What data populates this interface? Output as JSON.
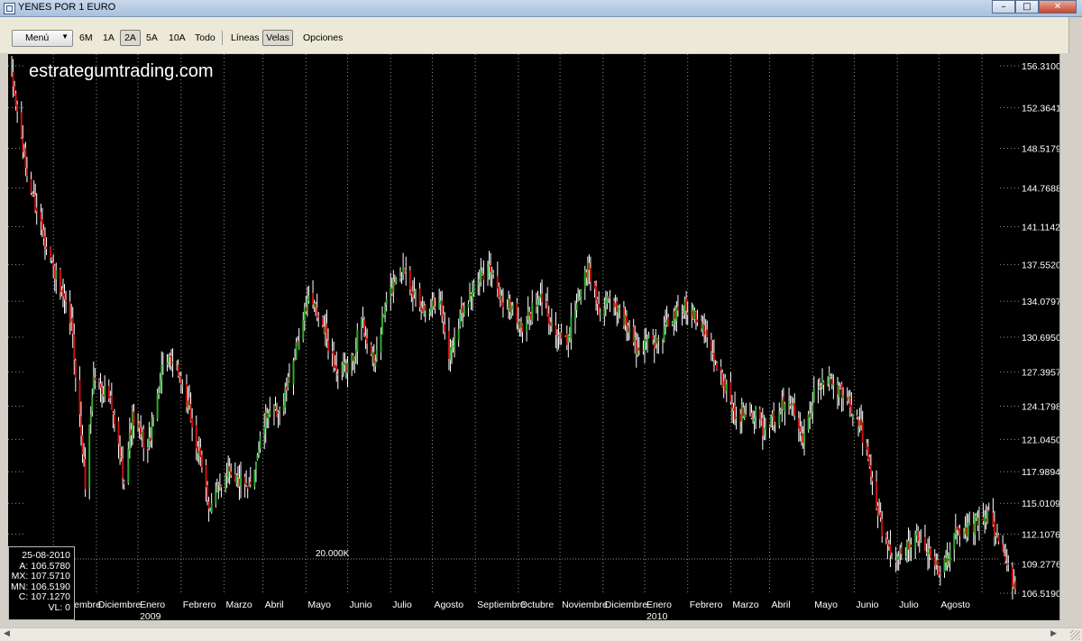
{
  "window": {
    "title": "YENES POR 1 EURO",
    "buttons": [
      "minimize",
      "maximize",
      "close"
    ]
  },
  "toolbar": {
    "menu_label": "Menú",
    "periods": [
      "6M",
      "1A",
      "2A",
      "5A",
      "10A",
      "Todo"
    ],
    "selected_period": "2A",
    "lines_label": "Líneas",
    "candles_label": "Velas",
    "options_label": "Opciones",
    "selected_style": "Velas"
  },
  "watermark": "estrategumtrading.com",
  "infobox": {
    "date": "25-08-2010",
    "open": "A: 106.5780",
    "high": "MX: 107.5710",
    "low": "MN: 106.5190",
    "close": "C: 107.1270",
    "volume": "VL: 0"
  },
  "colors": {
    "background": "#000000",
    "up": "#2ea82e",
    "down": "#c81010",
    "wick": "#ffffff",
    "grid": "#909090",
    "text": "#ffffff"
  },
  "chart_data": {
    "type": "candlestick",
    "series": [
      {
        "name": "YENES POR 1 EURO",
        "ohlc": []
      }
    ],
    "y_ticks": [
      "156.3100",
      "152.3641",
      "148.5179",
      "144.7688",
      "141.1142",
      "137.5520",
      "134.0797",
      "130.6950",
      "127.3957",
      "124.1798",
      "121.0450",
      "117.9894",
      "115.0109",
      "112.1076",
      "109.2776",
      "106.5190"
    ],
    "x_ticks": [
      {
        "label": "Noviembre"
      },
      {
        "label": "Diciembre"
      },
      {
        "label": "Enero",
        "year": "2009"
      },
      {
        "label": "Febrero"
      },
      {
        "label": "Marzo"
      },
      {
        "label": "Abril"
      },
      {
        "label": "Mayo"
      },
      {
        "label": "Junio"
      },
      {
        "label": "Julio"
      },
      {
        "label": "Agosto"
      },
      {
        "label": "Septiembre"
      },
      {
        "label": "Octubre"
      },
      {
        "label": "Noviembre"
      },
      {
        "label": "Diciembre"
      },
      {
        "label": "Enero",
        "year": "2010"
      },
      {
        "label": "Febrero"
      },
      {
        "label": "Marzo"
      },
      {
        "label": "Abril"
      },
      {
        "label": "Mayo"
      },
      {
        "label": "Junio"
      },
      {
        "label": "Julio"
      },
      {
        "label": "Agosto"
      }
    ],
    "volume_label": "20.000K",
    "anchors": [
      {
        "d": "2008-09-01",
        "v": 155.2
      },
      {
        "d": "2008-09-12",
        "v": 146.0
      },
      {
        "d": "2008-09-24",
        "v": 140.5
      },
      {
        "d": "2008-10-08",
        "v": 134.0
      },
      {
        "d": "2008-10-14",
        "v": 132.0
      },
      {
        "d": "2008-10-24",
        "v": 117.0
      },
      {
        "d": "2008-10-30",
        "v": 127.0
      },
      {
        "d": "2008-11-10",
        "v": 125.0
      },
      {
        "d": "2008-11-21",
        "v": 117.5
      },
      {
        "d": "2008-11-27",
        "v": 123.0
      },
      {
        "d": "2008-12-08",
        "v": 120.0
      },
      {
        "d": "2008-12-19",
        "v": 128.5
      },
      {
        "d": "2008-12-30",
        "v": 127.5
      },
      {
        "d": "2009-01-08",
        "v": 123.0
      },
      {
        "d": "2009-01-22",
        "v": 114.5
      },
      {
        "d": "2009-02-04",
        "v": 118.5
      },
      {
        "d": "2009-02-18",
        "v": 116.0
      },
      {
        "d": "2009-03-05",
        "v": 124.0
      },
      {
        "d": "2009-03-12",
        "v": 123.0
      },
      {
        "d": "2009-03-24",
        "v": 129.0
      },
      {
        "d": "2009-04-03",
        "v": 134.5
      },
      {
        "d": "2009-04-15",
        "v": 131.0
      },
      {
        "d": "2009-04-24",
        "v": 127.0
      },
      {
        "d": "2009-05-04",
        "v": 128.5
      },
      {
        "d": "2009-05-11",
        "v": 132.5
      },
      {
        "d": "2009-05-20",
        "v": 128.0
      },
      {
        "d": "2009-05-28",
        "v": 133.5
      },
      {
        "d": "2009-06-05",
        "v": 136.5
      },
      {
        "d": "2009-06-12",
        "v": 137.2
      },
      {
        "d": "2009-06-22",
        "v": 133.0
      },
      {
        "d": "2009-07-06",
        "v": 134.5
      },
      {
        "d": "2009-07-13",
        "v": 129.0
      },
      {
        "d": "2009-07-24",
        "v": 134.0
      },
      {
        "d": "2009-08-04",
        "v": 136.0
      },
      {
        "d": "2009-08-10",
        "v": 137.7
      },
      {
        "d": "2009-08-20",
        "v": 134.0
      },
      {
        "d": "2009-08-28",
        "v": 133.5
      },
      {
        "d": "2009-09-03",
        "v": 131.5
      },
      {
        "d": "2009-09-10",
        "v": 133.0
      },
      {
        "d": "2009-09-18",
        "v": 134.5
      },
      {
        "d": "2009-09-28",
        "v": 131.0
      },
      {
        "d": "2009-10-05",
        "v": 130.0
      },
      {
        "d": "2009-10-14",
        "v": 134.5
      },
      {
        "d": "2009-10-21",
        "v": 137.3
      },
      {
        "d": "2009-10-30",
        "v": 133.0
      },
      {
        "d": "2009-11-05",
        "v": 134.0
      },
      {
        "d": "2009-11-13",
        "v": 133.5
      },
      {
        "d": "2009-11-27",
        "v": 129.0
      },
      {
        "d": "2009-12-03",
        "v": 131.0
      },
      {
        "d": "2009-12-10",
        "v": 130.0
      },
      {
        "d": "2009-12-18",
        "v": 132.0
      },
      {
        "d": "2009-12-28",
        "v": 133.5
      },
      {
        "d": "2010-01-06",
        "v": 133.0
      },
      {
        "d": "2010-01-14",
        "v": 131.5
      },
      {
        "d": "2010-01-22",
        "v": 127.5
      },
      {
        "d": "2010-01-29",
        "v": 126.0
      },
      {
        "d": "2010-02-05",
        "v": 123.0
      },
      {
        "d": "2010-02-12",
        "v": 124.0
      },
      {
        "d": "2010-02-19",
        "v": 123.5
      },
      {
        "d": "2010-02-26",
        "v": 121.5
      },
      {
        "d": "2010-03-08",
        "v": 124.0
      },
      {
        "d": "2010-03-18",
        "v": 124.5
      },
      {
        "d": "2010-03-25",
        "v": 121.5
      },
      {
        "d": "2010-04-05",
        "v": 126.5
      },
      {
        "d": "2010-04-12",
        "v": 127.0
      },
      {
        "d": "2010-04-20",
        "v": 125.5
      },
      {
        "d": "2010-04-27",
        "v": 124.5
      },
      {
        "d": "2010-05-04",
        "v": 123.0
      },
      {
        "d": "2010-05-10",
        "v": 119.5
      },
      {
        "d": "2010-05-18",
        "v": 114.0
      },
      {
        "d": "2010-05-26",
        "v": 110.5
      },
      {
        "d": "2010-06-04",
        "v": 110.0
      },
      {
        "d": "2010-06-14",
        "v": 112.0
      },
      {
        "d": "2010-06-22",
        "v": 111.0
      },
      {
        "d": "2010-06-30",
        "v": 108.5
      },
      {
        "d": "2010-07-06",
        "v": 109.5
      },
      {
        "d": "2010-07-13",
        "v": 112.0
      },
      {
        "d": "2010-07-22",
        "v": 112.5
      },
      {
        "d": "2010-07-30",
        "v": 113.5
      },
      {
        "d": "2010-08-05",
        "v": 114.0
      },
      {
        "d": "2010-08-11",
        "v": 112.0
      },
      {
        "d": "2010-08-18",
        "v": 109.5
      },
      {
        "d": "2010-08-25",
        "v": 107.1
      }
    ]
  }
}
